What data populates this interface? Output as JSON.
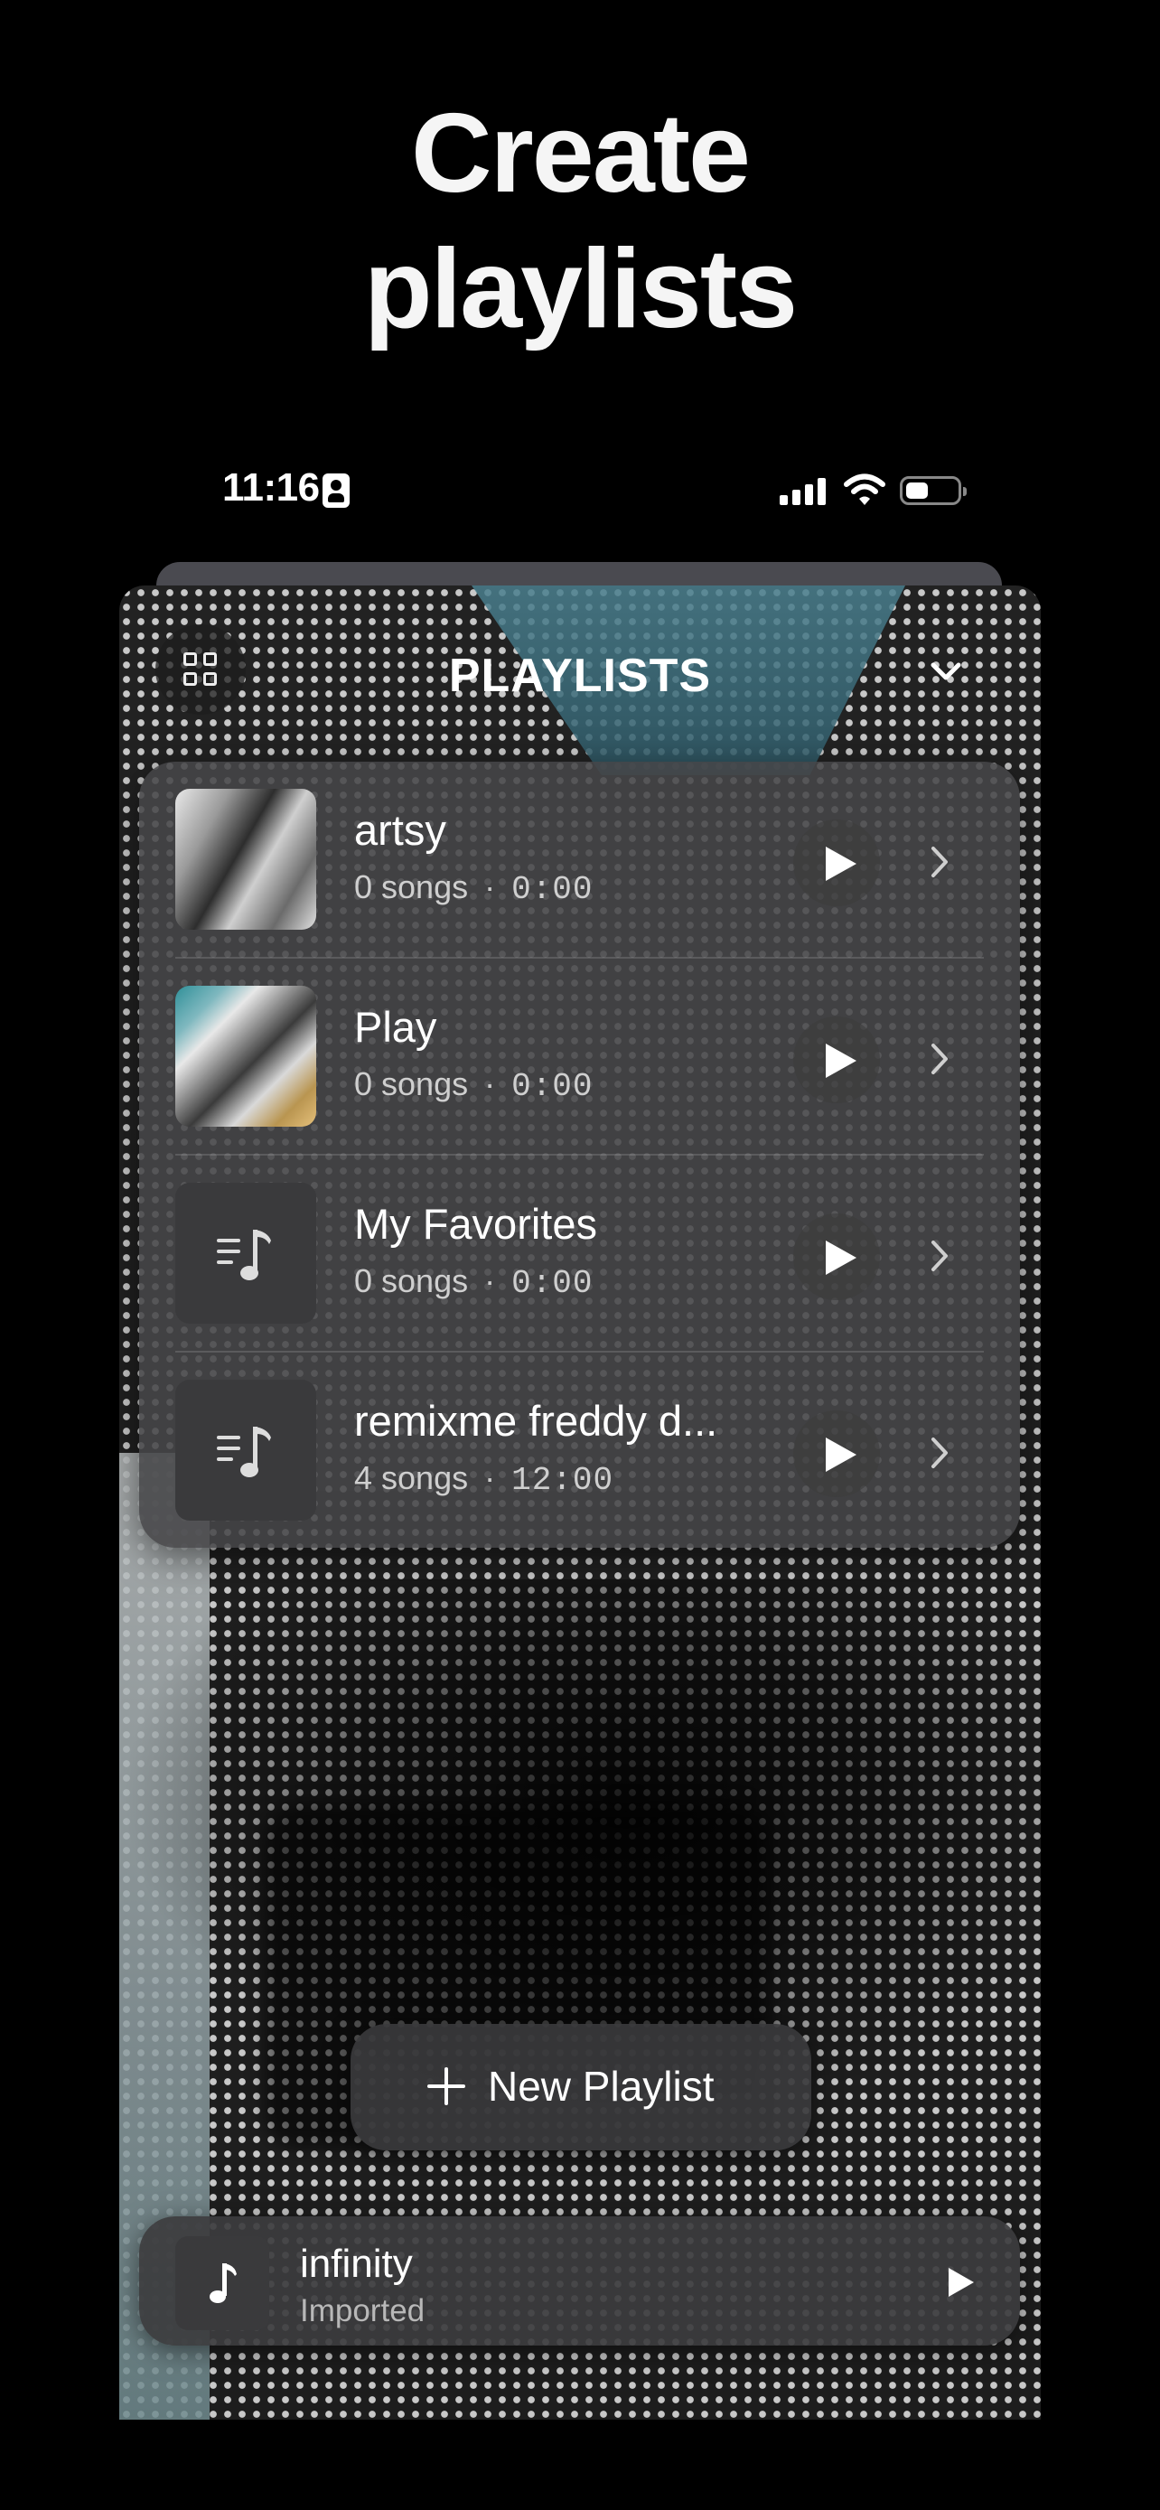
{
  "headline": {
    "line1": "Create",
    "line2": "playlists"
  },
  "status_bar": {
    "time": "11:16"
  },
  "header": {
    "title": "PLAYLISTS"
  },
  "playlists": [
    {
      "name": "artsy",
      "songs": "0 songs",
      "duration": "0:00",
      "thumbnail": "cover-art"
    },
    {
      "name": "Play",
      "songs": "0 songs",
      "duration": "0:00",
      "thumbnail": "cover-art"
    },
    {
      "name": "My Favorites",
      "songs": "0 songs",
      "duration": "0:00",
      "thumbnail": "music-list-icon"
    },
    {
      "name": "remixme freddy d...",
      "songs": "4 songs",
      "duration": "12:00",
      "thumbnail": "music-list-icon"
    }
  ],
  "actions": {
    "new_playlist_label": "New Playlist"
  },
  "mini_player": {
    "title": "infinity",
    "subtitle": "Imported"
  },
  "icons": {
    "grid": "grid-icon",
    "collapse": "chevron-down-icon",
    "play": "play-icon",
    "row_chevron": "chevron-right-icon",
    "add": "plus-icon"
  },
  "colors": {
    "background": "#000000",
    "panel": "#464648",
    "text": "#ffffff",
    "secondary_text": "#cfcfcf"
  }
}
